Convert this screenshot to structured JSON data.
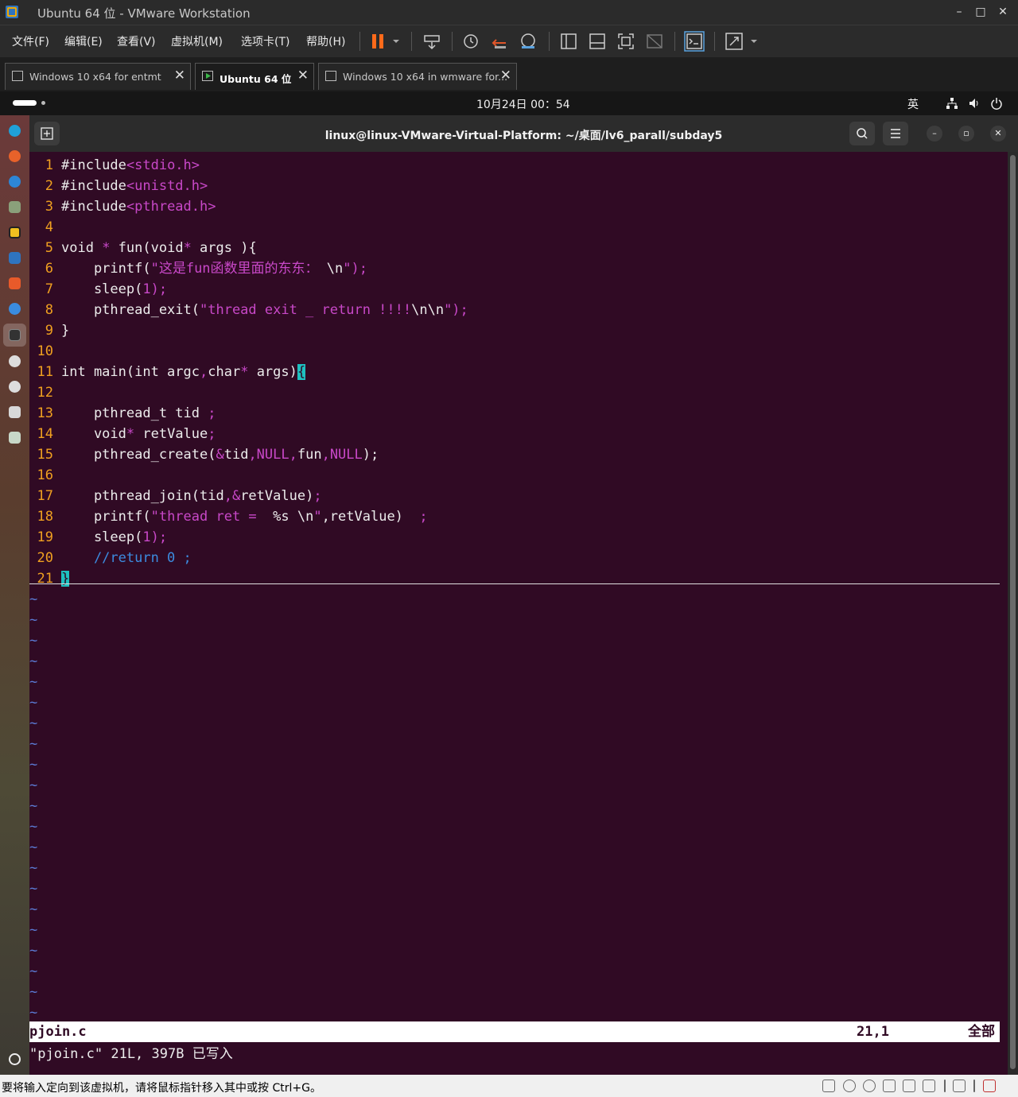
{
  "window": {
    "title": "Ubuntu 64 位 - VMware Workstation",
    "min": "–",
    "max": "□",
    "close": "✕"
  },
  "menu": [
    "文件(F)",
    "编辑(E)",
    "查看(V)",
    "虚拟机(M)",
    "选项卡(T)",
    "帮助(H)"
  ],
  "tabs": [
    {
      "label": "Windows 10 x64 for entmt"
    },
    {
      "label": "Ubuntu 64 位"
    },
    {
      "label": "Windows 10 x64 in wmware for..."
    }
  ],
  "ubuntu_bar": {
    "clock": "10月24日  00：54",
    "input_method": "英"
  },
  "terminal": {
    "title": "linux@linux-VMware-Virtual-Platform: ~/桌面/lv6_parall/subday5",
    "line_numbers": [
      "1",
      "2",
      "3",
      "4",
      "5",
      "6",
      "7",
      "8",
      "9",
      "10",
      "11",
      "12",
      "13",
      "14",
      "15",
      "16",
      "17",
      "18",
      "19",
      "20",
      "21"
    ],
    "code": {
      "l1_a": "#include",
      "l1_b": "<stdio.h>",
      "l2_a": "#include",
      "l2_b": "<unistd.h>",
      "l3_a": "#include",
      "l3_b": "<pthread.h>",
      "l5_a": "void ",
      "l5_b": "*",
      "l5_c": " fun(void",
      "l5_d": "*",
      "l5_e": " args ){",
      "l6_a": "    printf(",
      "l6_b": "\"这是fun函数里面的东东：",
      "l6_c": " \\n",
      "l6_d": "\");",
      "l7_a": "    sleep(",
      "l7_b": "1",
      "l7_c": ");",
      "l8_a": "    pthread_exit(",
      "l8_b": "\"thread exit _ return !!!!",
      "l8_c": "\\n\\n",
      "l8_d": "\");",
      "l9": "}",
      "l11_a": "int main(int argc",
      "l11_b": ",",
      "l11_c": "char",
      "l11_d": "*",
      "l11_e": " args)",
      "l11_f": "{",
      "l13_a": "    pthread_t tid ",
      "l13_b": ";",
      "l14_a": "    void",
      "l14_b": "*",
      "l14_c": " retValue",
      "l14_d": ";",
      "l15_a": "    pthread_create(",
      "l15_b": "&",
      "l15_c": "tid",
      "l15_d": ",NULL,",
      "l15_e": "fun",
      "l15_f": ",NULL",
      "l15_g": ");",
      "l17_a": "    pthread_join(tid",
      "l17_b": ",&",
      "l17_c": "retValue)",
      "l17_d": ";",
      "l18_a": "    printf(",
      "l18_b": "\"thread ret =  ",
      "l18_c": "%s \\n",
      "l18_d": "\"",
      "l18_e": ",retValue)  ",
      "l18_f": ";",
      "l19_a": "    sleep(",
      "l19_b": "1",
      "l19_c": ");",
      "l20": "    //return 0 ;",
      "l21": "}"
    },
    "tilde": "~",
    "status_file": "pjoin.c",
    "status_pos": "21,1",
    "status_all": "全部",
    "cmdline": "\"pjoin.c\" 21L, 397B 已写入"
  },
  "vm_status": "要将输入定向到该虚拟机，请将鼠标指针移入其中或按 Ctrl+G。",
  "colors": {
    "terminal_bg": "#300a24",
    "accent": "#1ec0c0",
    "line_number": "#f0a020",
    "string": "#c848c8"
  }
}
